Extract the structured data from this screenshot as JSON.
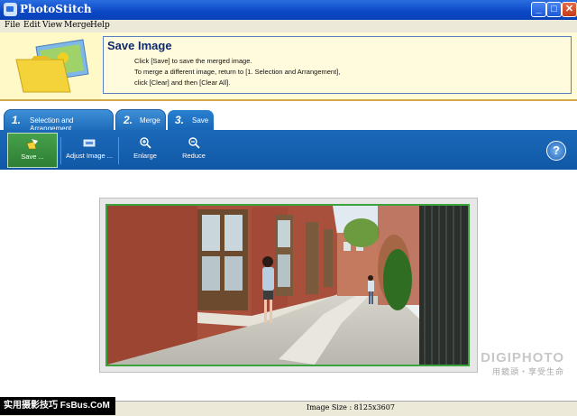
{
  "window": {
    "title": "PhotoStitch",
    "minimize": "_",
    "maximize": "□",
    "close": "✕"
  },
  "menu": [
    "File",
    "Edit",
    "View",
    "Merge",
    "Help"
  ],
  "banner": {
    "title": "Save Image",
    "lines": [
      "Click [Save] to save the merged image.",
      "To merge a different image, return to [1. Selection and Arrangement],",
      "click [Clear] and then [Clear All]."
    ]
  },
  "tabs": [
    {
      "num": "1.",
      "label": "Selection and Arrangement"
    },
    {
      "num": "2.",
      "label": "Merge"
    },
    {
      "num": "3.",
      "label": "Save"
    }
  ],
  "toolbar": {
    "buttons": [
      "Save ...",
      "Adjust Image ...",
      "Enlarge",
      "Reduce"
    ],
    "help": "?"
  },
  "status": {
    "image_size": "Image Size : 8125x3607"
  },
  "watermarks": {
    "left": "实用摄影技巧 FsBus.CoM",
    "right_top": "DIGIPHOTO",
    "right_bottom": "用鏡頭・享受生命"
  }
}
